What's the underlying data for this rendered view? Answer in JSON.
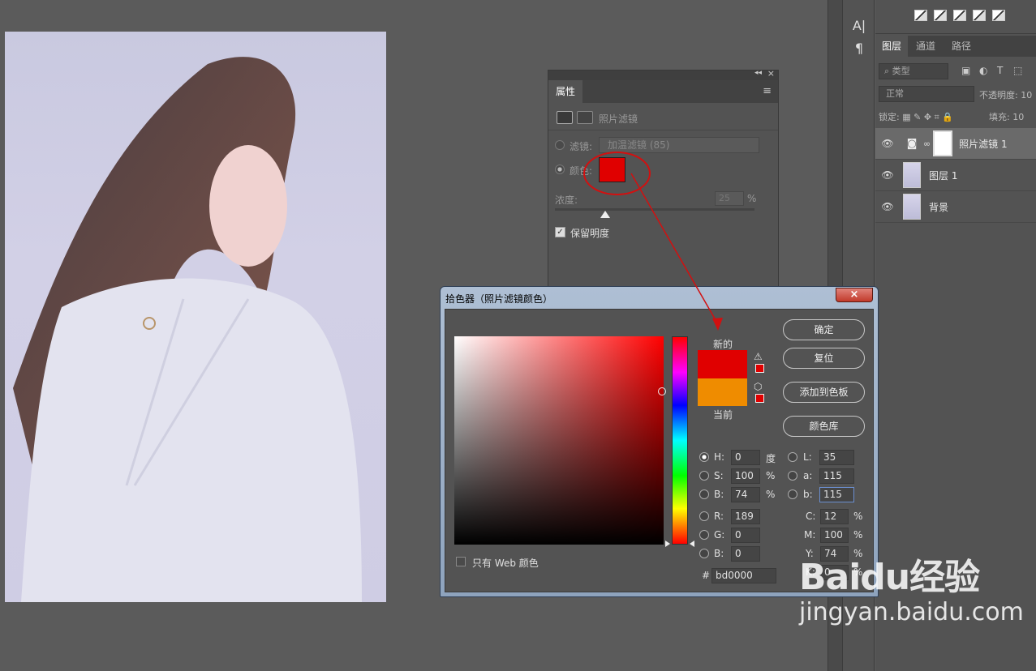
{
  "toolbar_glyphs": {
    "text": "A|",
    "paragraph": "¶"
  },
  "layers_panel": {
    "tabs": [
      "图层",
      "通道",
      "路径"
    ],
    "filter_label": "类型",
    "blend_mode": "正常",
    "opacity_label": "不透明度:",
    "opacity_value": "10",
    "lock_label": "锁定:",
    "fill_label": "填充:",
    "fill_value": "10",
    "layers": [
      {
        "name": "照片滤镜 1",
        "selected": true
      },
      {
        "name": "图层 1",
        "selected": false
      },
      {
        "name": "背景",
        "selected": false
      }
    ]
  },
  "properties_panel": {
    "tab": "属性",
    "title": "照片滤镜",
    "filter_label": "滤镜:",
    "filter_value": "加温滤镜 (85)",
    "color_label": "颜色:",
    "color": "#e00000",
    "density_label": "浓度:",
    "density_value": "25",
    "density_unit": "%",
    "density_level": 0.25,
    "preserve_label": "保留明度",
    "preserve_checked": true
  },
  "color_picker": {
    "title": "拾色器（照片滤镜颜色）",
    "close": "×",
    "new_label": "新的",
    "current_label": "当前",
    "new_color": "#e00000",
    "current_color": "#ef8c00",
    "buttons": {
      "ok": "确定",
      "reset": "复位",
      "add_swatch": "添加到色板",
      "libraries": "颜色库"
    },
    "web_only_label": "只有 Web 颜色",
    "hsb": {
      "h_label": "H:",
      "h": "0",
      "h_unit": "度",
      "s_label": "S:",
      "s": "100",
      "s_unit": "%",
      "b_label": "B:",
      "b": "74",
      "b_unit": "%"
    },
    "rgb": {
      "r_label": "R:",
      "r": "189",
      "g_label": "G:",
      "g": "0",
      "b_label": "B:",
      "b": "0"
    },
    "lab": {
      "l_label": "L:",
      "l": "35",
      "a_label": "a:",
      "a": "115",
      "b_label": "b:",
      "b": "115"
    },
    "cmyk": {
      "c_label": "C:",
      "c": "12",
      "m_label": "M:",
      "m": "100",
      "y_label": "Y:",
      "y": "74",
      "k_label": "K:",
      "k": "0",
      "unit": "%"
    },
    "hex_label": "#",
    "hex": "bd0000"
  },
  "watermark": {
    "logo": "Baidu经验",
    "url": "jingyan.baidu.com"
  }
}
